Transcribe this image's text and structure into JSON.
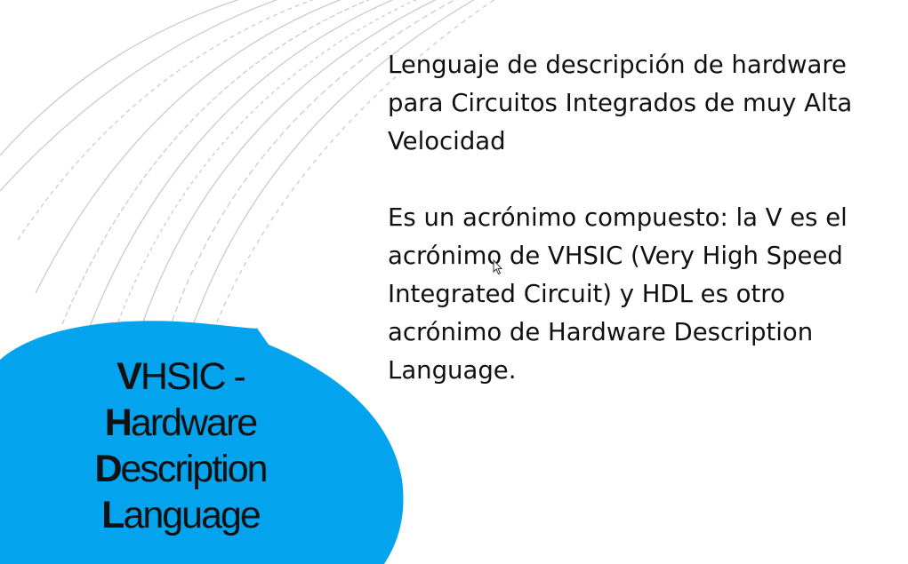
{
  "slide": {
    "title_lines": [
      {
        "initial": "V",
        "rest": "HSIC -"
      },
      {
        "initial": "H",
        "rest": "ardware"
      },
      {
        "initial": "D",
        "rest": "escription"
      },
      {
        "initial": "L",
        "rest": "anguage"
      }
    ],
    "paragraph_1": "Lenguaje de descripción de hardware para Circuitos Integrados de muy Alta Velocidad",
    "paragraph_2": "Es un acrónimo compuesto: la V es el acrónimo de VHSIC (Very High Speed Integrated Circuit) y HDL es otro acrónimo de Hardware Description Language."
  },
  "colors": {
    "bubble": "#03a3ee",
    "arc_lines": "#c8c8c8",
    "text": "#111111",
    "background": "#ffffff"
  },
  "icons": {
    "cursor": "mouse-pointer-icon"
  }
}
